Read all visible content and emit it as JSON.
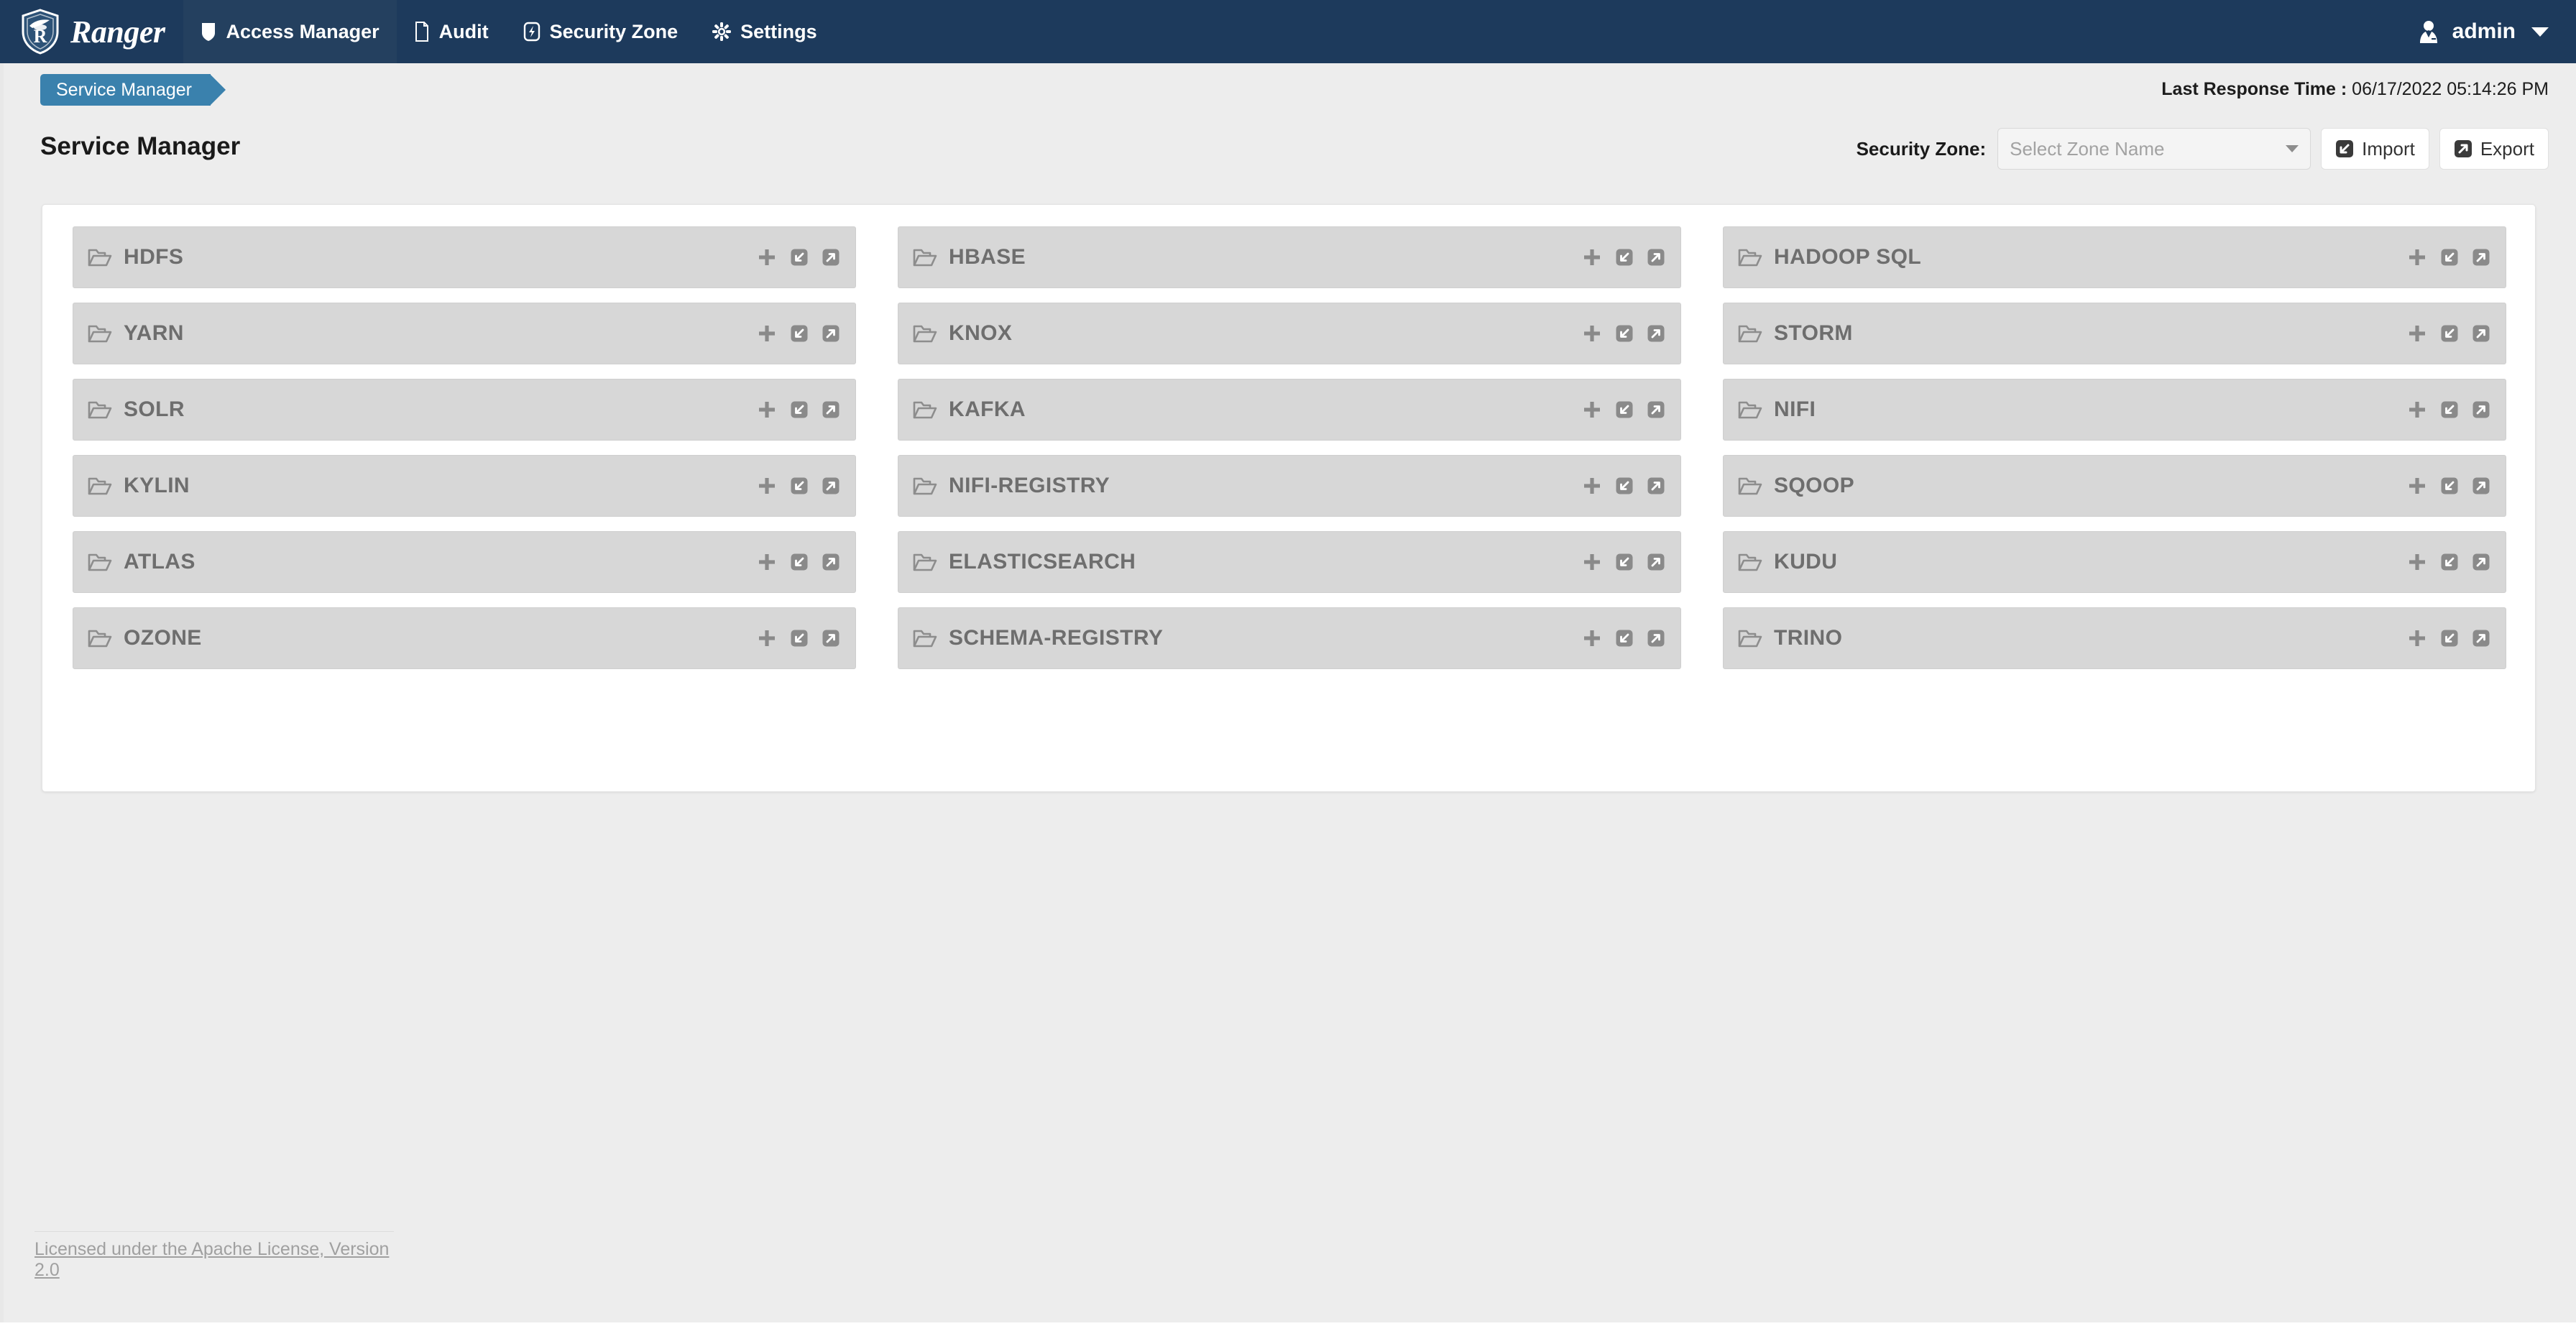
{
  "navbar": {
    "brand": "Ranger",
    "brand_logo_icon": "ranger-shield-logo",
    "items": [
      {
        "label": "Access Manager",
        "icon": "shield-icon",
        "active": true
      },
      {
        "label": "Audit",
        "icon": "document-icon",
        "active": false
      },
      {
        "label": "Security Zone",
        "icon": "lightning-bolt-icon",
        "active": false
      },
      {
        "label": "Settings",
        "icon": "gear-icon",
        "active": false
      }
    ],
    "user": {
      "name": "admin",
      "avatar_icon": "user-suit-icon",
      "caret_icon": "chevron-down-icon"
    }
  },
  "breadcrumb": {
    "label": "Service Manager"
  },
  "status": {
    "last_response_label": "Last Response Time : ",
    "last_response_value": "06/17/2022 05:14:26 PM"
  },
  "header": {
    "page_title": "Service Manager"
  },
  "toolbar": {
    "security_zone_label": "Security Zone:",
    "zone_placeholder": "Select Zone Name",
    "zone_value": "",
    "zone_caret_icon": "chevron-down-icon",
    "import_label": "Import",
    "import_icon": "import-arrow-icon",
    "export_label": "Export",
    "export_icon": "export-arrow-icon"
  },
  "services": {
    "row_icon": "open-folder-icon",
    "action_add_icon": "plus-icon",
    "action_import_icon": "import-arrow-icon",
    "action_export_icon": "export-arrow-icon",
    "columns": [
      [
        {
          "name": "HDFS"
        },
        {
          "name": "YARN"
        },
        {
          "name": "SOLR"
        },
        {
          "name": "KYLIN"
        },
        {
          "name": "ATLAS"
        },
        {
          "name": "OZONE"
        }
      ],
      [
        {
          "name": "HBASE"
        },
        {
          "name": "KNOX"
        },
        {
          "name": "KAFKA"
        },
        {
          "name": "NIFI-REGISTRY"
        },
        {
          "name": "ELASTICSEARCH"
        },
        {
          "name": "SCHEMA-REGISTRY"
        }
      ],
      [
        {
          "name": "HADOOP SQL"
        },
        {
          "name": "STORM"
        },
        {
          "name": "NIFI"
        },
        {
          "name": "SQOOP"
        },
        {
          "name": "KUDU"
        },
        {
          "name": "TRINO"
        }
      ]
    ]
  },
  "footer": {
    "license_text": "Licensed under the Apache License, Version 2.0"
  },
  "colors": {
    "navbar_bg": "#1d3a5c",
    "navbar_active_bg": "#24405f",
    "breadcrumb_bg": "#3a81ad",
    "page_bg": "#ededed",
    "card_bg": "#ffffff",
    "service_row_bg": "#d7d7d7",
    "service_text": "#6e6e6e"
  }
}
